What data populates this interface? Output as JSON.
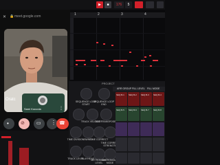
{
  "browser": {
    "url": "meet.google.com"
  },
  "call": {
    "self_name": "Sami Kouvola",
    "caption_partial": "Oratc",
    "buttons": [
      "mic-icon",
      "camera-off-icon",
      "present-icon",
      "more-icon",
      "end-call-icon"
    ]
  },
  "daw": {
    "topbar": {
      "tab1": "▶",
      "tab2": "■",
      "counter": "176",
      "counter2": "5"
    },
    "ruler": [
      "1",
      "2",
      "3",
      "4"
    ],
    "project_label": "PROJECT",
    "tabs": [
      "ARR GROUP",
      "FILL LEVEL",
      "FILL MODE"
    ],
    "knobs_row1": [
      {
        "label": "SEQUENCE\nLOOP START",
        "value": "Bar 1"
      },
      {
        "label": "SEQUENCE\nLOOP END",
        "value": "Bar 4"
      }
    ],
    "knobs_row2": [
      {
        "label": "SWING"
      },
      {
        "label": "TRACK\nVELOCITY"
      },
      {
        "label": "TIME\nTRANSPOSE"
      }
    ],
    "knobs_row3": [
      {
        "label": "TIME DIVISION"
      },
      {
        "label": "SWING"
      },
      {
        "label": "TIME CORRECT"
      },
      {
        "label": "TIME CORRECT\nSTRENGTH"
      }
    ],
    "knobs_row4": [
      {
        "label": "TRACK LEVEL"
      },
      {
        "label": "PLAYHEAD"
      },
      {
        "label": "METRONOME\nLEVEL"
      },
      {
        "label": "METRONOME\nMODE"
      }
    ],
    "pad_labels": [
      "SEQ B-1",
      "SEQ B-2",
      "SEQ B-3",
      "SEQ B-4",
      "SEQ B-5",
      "SEQ B-6",
      "SEQ B-7",
      "SEQ B-8"
    ],
    "colors": {
      "accent": "#e0323b",
      "pad_red": "#6d1616",
      "pad_green": "#28452f",
      "pad_purple": "#3e2b57"
    }
  }
}
